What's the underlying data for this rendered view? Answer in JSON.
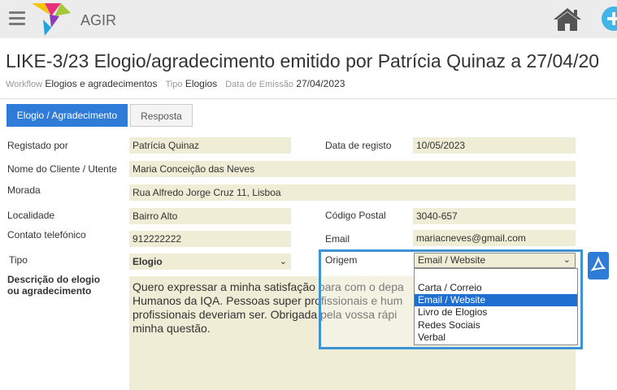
{
  "app": {
    "name": "AGIR"
  },
  "page": {
    "title": "LIKE-3/23 Elogio/agradecimento emitido por Patrícia Quinaz a 27/04/20",
    "workflow_key": "Workflow",
    "workflow_value": "Elogios e agradecimentos",
    "type_key": "Tipo",
    "type_value": "Elogios",
    "date_key": "Data de Emissão",
    "date_value": "27/04/2023"
  },
  "tabs": [
    {
      "label": "Elogio / Agradecimento",
      "active": true
    },
    {
      "label": "Resposta",
      "active": false
    }
  ],
  "form": {
    "registado_por_label": "Registado por",
    "registado_por_value": "Patrícia Quinaz",
    "data_registo_label": "Data de registo",
    "data_registo_value": "10/05/2023",
    "cliente_label": "Nome do Cliente / Utente",
    "cliente_value": "Maria Conceição das Neves",
    "morada_label": "Morada",
    "morada_value": "Rua Alfredo Jorge Cruz 11, Lisboa",
    "localidade_label": "Localidade",
    "localidade_value": "Bairro Alto",
    "codigo_postal_label": "Código Postal",
    "codigo_postal_value": "3040-657",
    "telefone_label": "Contato telefónico",
    "telefone_value": "912222222",
    "email_label": "Email",
    "email_value": "mariacneves@gmail.com",
    "tipo_label": "Tipo",
    "tipo_value": "Elogio",
    "origem_label": "Origem",
    "origem_value": "Email / Website",
    "descricao_label_1": "Descrição do elogio",
    "descricao_label_2": "ou agradecimento",
    "descricao_lines": [
      "Quero expressar a minha satisfação para com o depa",
      "Humanos da IQA. Pessoas super profissionais e hum",
      "profissionais deveriam ser. Obrigada pela vossa rápi",
      "minha questão."
    ]
  },
  "origem_options": [
    "",
    "Carta / Correio",
    "Email / Website",
    "Livro de Elogios",
    "Redes Sociais",
    "Verbal"
  ],
  "origem_selected_index": 2,
  "colors": {
    "accent": "#2e7bd8",
    "field_bg": "#efedd5",
    "highlight_border": "#3d93d6"
  }
}
